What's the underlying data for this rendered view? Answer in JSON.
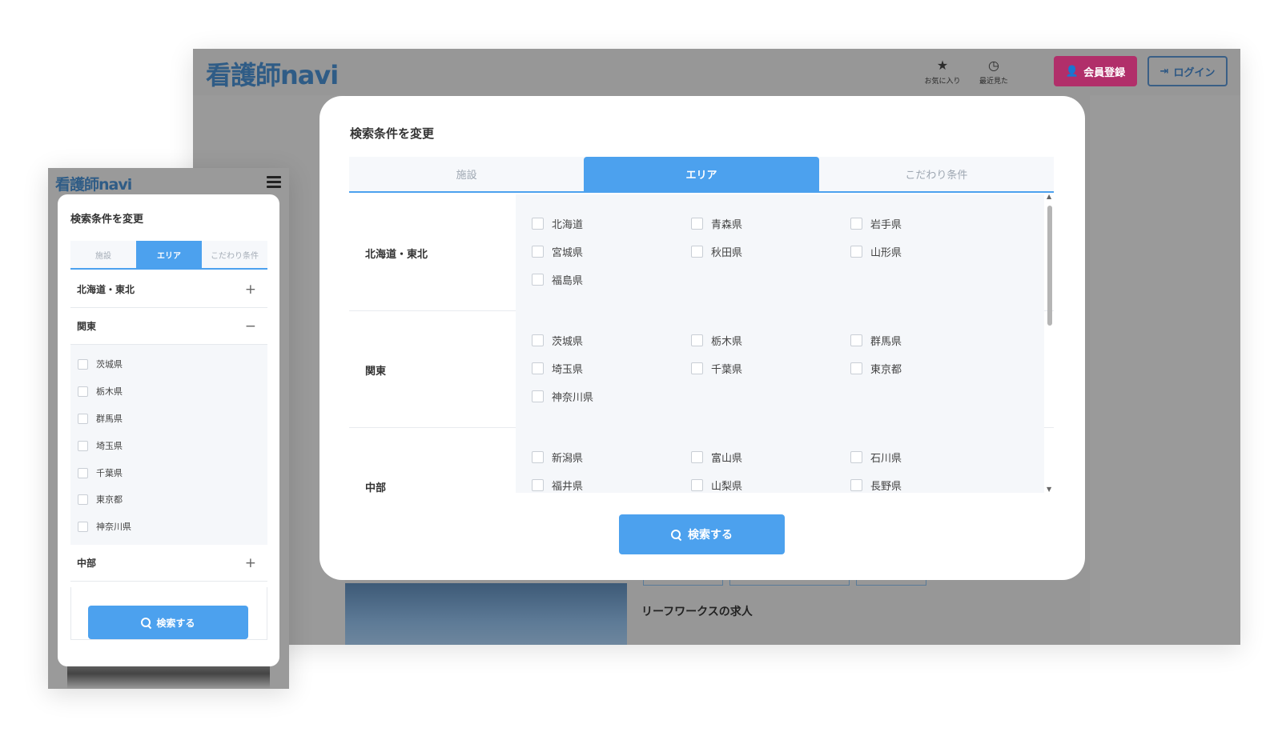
{
  "colors": {
    "accent": "#4ca1ee",
    "register": "#b12f6a",
    "login_border": "#3a5f86",
    "logo": "#2f5c86"
  },
  "desktop": {
    "logo": "看護師navi",
    "header": {
      "favorites_label": "お気に入り",
      "favorites_icon": "star-icon",
      "recent_label": "最近見た",
      "recent_icon": "clock-icon",
      "register_label": "会員登録",
      "register_icon": "user-plus-icon",
      "login_label": "ログイン",
      "login_icon": "sign-in-icon"
    },
    "background": {
      "section_title": "リーフワークスの求人"
    },
    "modal": {
      "title": "検索条件を変更",
      "tabs": [
        {
          "label": "施設",
          "active": false
        },
        {
          "label": "エリア",
          "active": true
        },
        {
          "label": "こだわり条件",
          "active": false
        }
      ],
      "regions": [
        {
          "name": "北海道・東北",
          "prefectures": [
            "北海道",
            "青森県",
            "岩手県",
            "宮城県",
            "秋田県",
            "山形県",
            "福島県"
          ]
        },
        {
          "name": "関東",
          "prefectures": [
            "茨城県",
            "栃木県",
            "群馬県",
            "埼玉県",
            "千葉県",
            "東京都",
            "神奈川県"
          ]
        },
        {
          "name": "中部",
          "prefectures": [
            "新潟県",
            "富山県",
            "石川県",
            "福井県",
            "山梨県",
            "長野県"
          ]
        }
      ],
      "search_label": "検索する"
    }
  },
  "mobile": {
    "logo": "看護師navi",
    "modal": {
      "title": "検索条件を変更",
      "tabs": [
        {
          "label": "施設",
          "active": false
        },
        {
          "label": "エリア",
          "active": true
        },
        {
          "label": "こだわり条件",
          "active": false
        }
      ],
      "accordions": [
        {
          "name": "北海道・東北",
          "sign": "+"
        },
        {
          "name": "関東",
          "sign": "−"
        },
        {
          "name": "中部",
          "sign": "+"
        }
      ],
      "kanto_prefectures": [
        "茨城県",
        "栃木県",
        "群馬県",
        "埼玉県",
        "千葉県",
        "東京都",
        "神奈川県"
      ],
      "search_label": "検索する"
    }
  }
}
